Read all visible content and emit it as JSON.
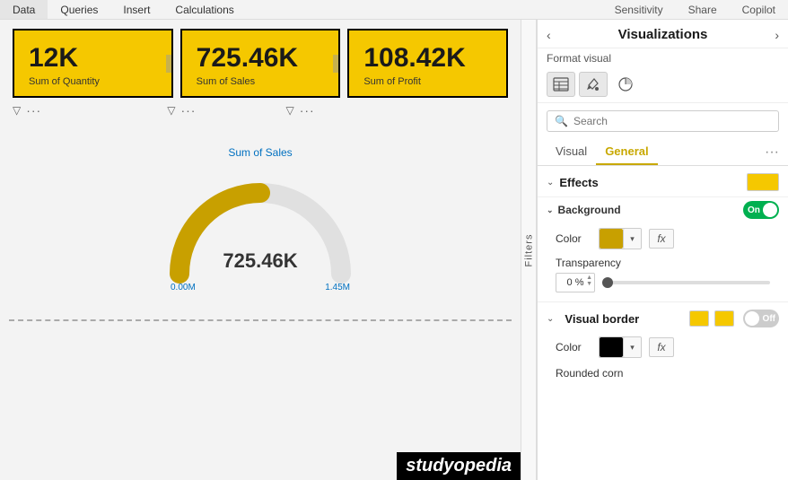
{
  "topbar": {
    "items": [
      "Data",
      "Queries",
      "Insert",
      "Calculations",
      "Sensitivity",
      "Share",
      "Copilot"
    ]
  },
  "kpis": [
    {
      "value": "12K",
      "label": "Sum of Quantity"
    },
    {
      "value": "725.46K",
      "label": "Sum of Sales"
    },
    {
      "value": "108.42K",
      "label": "Sum of Profit"
    }
  ],
  "gauge": {
    "title": "Sum of Sales",
    "value": "725.46K",
    "min": "0.00M",
    "max": "1.45M"
  },
  "panel": {
    "title": "Visualizations",
    "format_visual_label": "Format visual",
    "search_placeholder": "Search",
    "tabs": [
      "Visual",
      "General"
    ],
    "active_tab": "General",
    "tabs_more": "···",
    "effects_label": "Effects",
    "background_label": "Background",
    "background_toggle": "On",
    "color_label": "Color",
    "transparency_label": "Transparency",
    "transparency_value": "0 %",
    "visual_border_label": "Visual border",
    "visual_border_toggle": "Off",
    "color_label2": "Color",
    "rounded_corners_label": "Rounded corn"
  },
  "colors": {
    "kpi_bg": "#f5c800",
    "effects_swatch": "#f5c800",
    "color_swatch": "#c8a000",
    "vb_swatch1": "#f5c800",
    "vb_swatch2": "#f5c800",
    "color_swatch2": "#000000",
    "toggle_on_bg": "#00b050",
    "toggle_off_bg": "#cccccc"
  }
}
